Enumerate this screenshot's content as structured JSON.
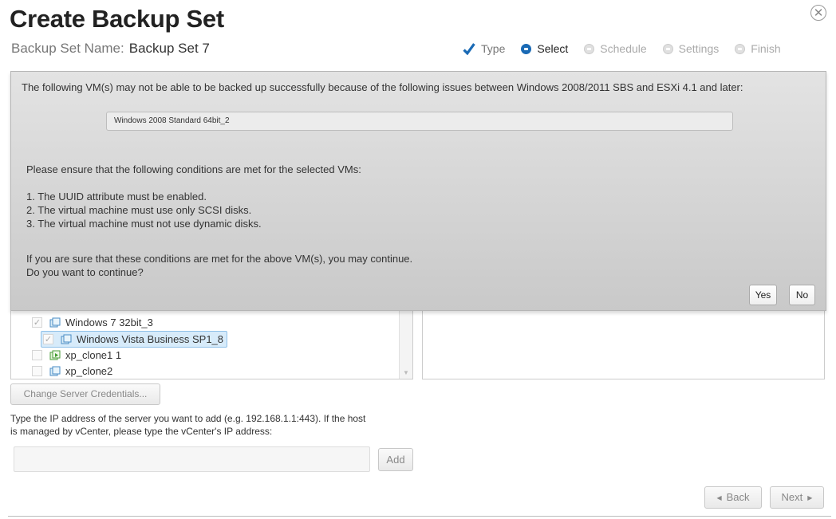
{
  "header": {
    "title": "Create Backup Set",
    "set_name_label": "Backup Set Name:",
    "set_name_value": "Backup Set 7"
  },
  "steps": [
    {
      "label": "Type",
      "state": "done"
    },
    {
      "label": "Select",
      "state": "active"
    },
    {
      "label": "Schedule",
      "state": "pending"
    },
    {
      "label": "Settings",
      "state": "pending"
    },
    {
      "label": "Finish",
      "state": "pending"
    }
  ],
  "dialog": {
    "warning": "The following VM(s) may not be able to be backed up successfully because of the following issues between Windows 2008/2011 SBS and ESXi 4.1 and later:",
    "vm_list": [
      "Windows 2008 Standard 64bit_2"
    ],
    "conditions_intro": "Please ensure that the following conditions are met for the selected VMs:",
    "conditions": [
      "1. The UUID attribute must be enabled.",
      "2. The virtual machine must use only SCSI disks.",
      "3. The virtual machine must not use dynamic disks."
    ],
    "confirm_line1": "If you are sure that these conditions are met for the above VM(s), you may continue.",
    "confirm_line2": "Do you want to continue?",
    "yes_label": "Yes",
    "no_label": "No"
  },
  "tree": {
    "items": [
      {
        "label": "Windows 7 32bit_3",
        "checked": true,
        "selected": false
      },
      {
        "label": "Windows Vista Business SP1_8",
        "checked": true,
        "selected": true
      },
      {
        "label": "xp_clone1 1",
        "checked": false,
        "selected": false
      },
      {
        "label": "xp_clone2",
        "checked": false,
        "selected": false
      }
    ]
  },
  "buttons": {
    "change_credentials": "Change Server Credentials...",
    "add": "Add",
    "back": "Back",
    "next": "Next"
  },
  "ip_field": {
    "instructions_line1": "Type the IP address of the server you want to add (e.g. 192.168.1.1:443). If the host",
    "instructions_line2": "is managed by vCenter, please type the vCenter's IP address:",
    "value": ""
  },
  "close_symbol": "✕",
  "colors": {
    "accent": "#1a6ab5",
    "check": "#1a6ab5",
    "dialog_bg": "#d4d4d4"
  }
}
